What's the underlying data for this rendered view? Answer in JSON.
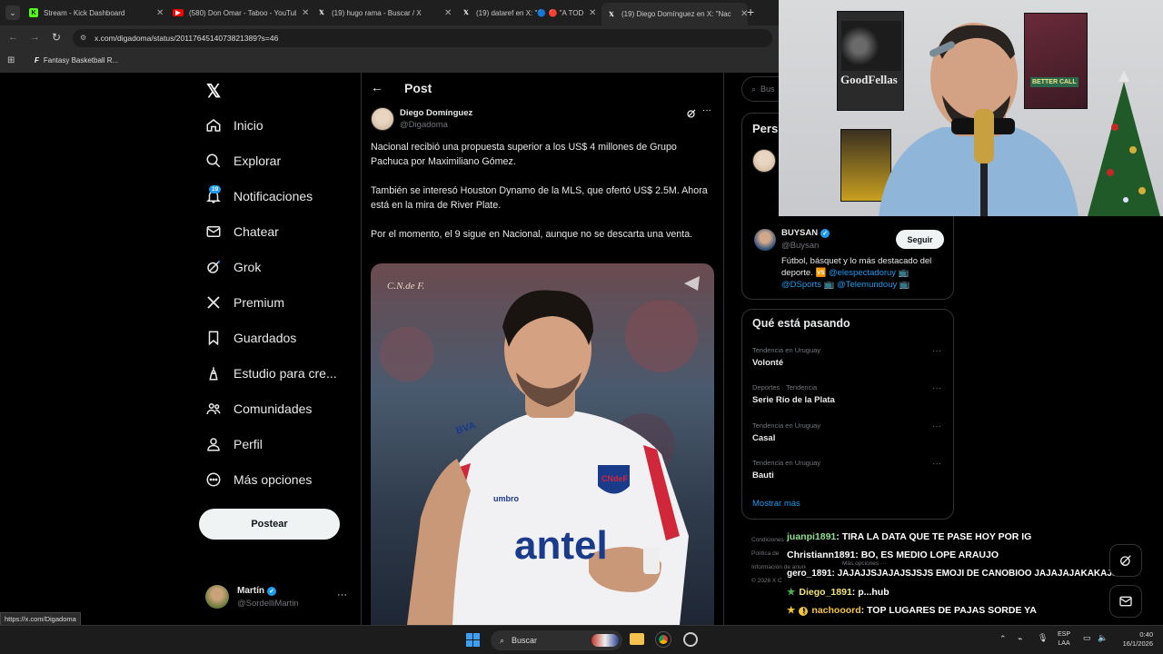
{
  "browser": {
    "tabs": [
      {
        "label": "Stream - Kick Dashboard",
        "icon": "kick-icon"
      },
      {
        "label": "(580) Don Omar - Taboo - YouTube",
        "icon": "youtube-icon"
      },
      {
        "label": "(19) hugo rama - Buscar / X",
        "icon": "x-icon"
      },
      {
        "label": "(19) dataref en X: \"🔵 🔴 \"A TOD",
        "icon": "x-icon"
      },
      {
        "label": "(19) Diego Domínguez en X: \"Nac",
        "icon": "x-icon"
      }
    ],
    "url": "x.com/digadoma/status/2011764514073821389?s=46",
    "bookmark": "Fantasy Basketball R...",
    "status_url": "https://x.com/Digadoma"
  },
  "nav": {
    "items": [
      {
        "label": "Inicio",
        "icon": "home-icon"
      },
      {
        "label": "Explorar",
        "icon": "search-icon"
      },
      {
        "label": "Notificaciones",
        "icon": "bell-icon",
        "badge": "19"
      },
      {
        "label": "Chatear",
        "icon": "mail-icon"
      },
      {
        "label": "Grok",
        "icon": "grok-icon"
      },
      {
        "label": "Premium",
        "icon": "x-logo-icon"
      },
      {
        "label": "Guardados",
        "icon": "bookmark-icon"
      },
      {
        "label": "Estudio para cre...",
        "icon": "studio-icon"
      },
      {
        "label": "Comunidades",
        "icon": "people-icon"
      },
      {
        "label": "Perfil",
        "icon": "person-icon"
      },
      {
        "label": "Más opciones",
        "icon": "more-circle-icon"
      }
    ],
    "post_button": "Postear",
    "account": {
      "name": "Martín",
      "handle": "@SordelliMartin"
    }
  },
  "post": {
    "header": "Post",
    "author": "Diego Domínguez",
    "handle": "@Digadoma",
    "paragraphs": [
      "Nacional recibió una propuesta superior a los US$ 4 millones de Grupo Pachuca por Maximiliano Gómez.",
      "También se interesó Houston Dynamo de la MLS, que ofertó US$ 2.5M. Ahora está en la mira de River Plate.",
      "Por el momento, el 9 sigue en Nacional, aunque no se descarta una venta."
    ],
    "image_watermark": "C.N.de F.",
    "image_sponsor": "antel",
    "image_brand": "BVA",
    "image_crest": "CNdeF",
    "image_kit": "umbro"
  },
  "right": {
    "search_placeholder": "Bus",
    "suggest_title": "Pers",
    "suggest": {
      "name": "BUYSAN",
      "handle": "@Buysan",
      "follow": "Seguir",
      "bio_text": "Fútbol, básquet y lo más destacado del deporte. 🆚",
      "bio_links": [
        "@elespectadoruy",
        "@DSports",
        "@Telemundouy"
      ]
    },
    "trends_title": "Qué está pasando",
    "trends": [
      {
        "category": "Tendencia en Uruguay",
        "name": "Volonté"
      },
      {
        "category": "Deportes · Tendencia",
        "name": "Serie Río de la Plata"
      },
      {
        "category": "Tendencia en Uruguay",
        "name": "Casal"
      },
      {
        "category": "Tendencia en Uruguay",
        "name": "Bauti"
      }
    ],
    "show_more": "Mostrar más",
    "footer": [
      "Condiciones",
      "Política de",
      "Información de anuncios",
      "Más opciones ···",
      "© 2026 X C"
    ]
  },
  "stream": {
    "poster_title": "GoodFellas",
    "poster2_title": "BETTER CALL",
    "chat": [
      {
        "user": "juanpi1891",
        "msg": ": TIRA LA DATA QUE TE PASE HOY POR IG",
        "color": "#7fd37f"
      },
      {
        "user": "Christiann1891",
        "msg": ": BO, ES MEDIO LOPE ARAUJO",
        "color": "#ffffff"
      },
      {
        "user": "gero_1891",
        "msg": ": JAJAJJSJAJAJSJSJS EMOJI DE CANOBIOO JAJAJAJAKAKAJJSKS",
        "color": "#ffffff"
      },
      {
        "user": "Diego_1891",
        "msg": ": p...hub",
        "color": "#f0e27a"
      },
      {
        "user": "nachooord",
        "msg": ": TOP LUGARES DE PAJAS SORDE YA",
        "color": "#f5c542"
      }
    ]
  },
  "taskbar": {
    "search": "Buscar",
    "lang": "ESP",
    "lang2": "LAA",
    "time": "0:40",
    "date": "16/1/2026"
  }
}
